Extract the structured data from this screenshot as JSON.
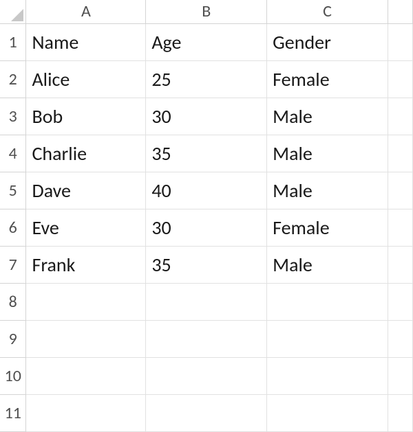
{
  "columns": [
    "A",
    "B",
    "C"
  ],
  "row_numbers": [
    "1",
    "2",
    "3",
    "4",
    "5",
    "6",
    "7",
    "8",
    "9",
    "10",
    "11"
  ],
  "cells": {
    "A1": "Name",
    "B1": "Age",
    "C1": "Gender",
    "A2": "Alice",
    "B2": "25",
    "C2": "Female",
    "A3": "Bob",
    "B3": "30",
    "C3": "Male",
    "A4": "Charlie",
    "B4": "35",
    "C4": "Male",
    "A5": "Dave",
    "B5": "40",
    "C5": "Male",
    "A6": "Eve",
    "B6": "30",
    "C6": "Female",
    "A7": "Frank",
    "B7": "35",
    "C7": "Male"
  },
  "chart_data": {
    "type": "table",
    "title": "",
    "columns": [
      "Name",
      "Age",
      "Gender"
    ],
    "rows": [
      {
        "Name": "Alice",
        "Age": 25,
        "Gender": "Female"
      },
      {
        "Name": "Bob",
        "Age": 30,
        "Gender": "Male"
      },
      {
        "Name": "Charlie",
        "Age": 35,
        "Gender": "Male"
      },
      {
        "Name": "Dave",
        "Age": 40,
        "Gender": "Male"
      },
      {
        "Name": "Eve",
        "Age": 30,
        "Gender": "Female"
      },
      {
        "Name": "Frank",
        "Age": 35,
        "Gender": "Male"
      }
    ]
  }
}
